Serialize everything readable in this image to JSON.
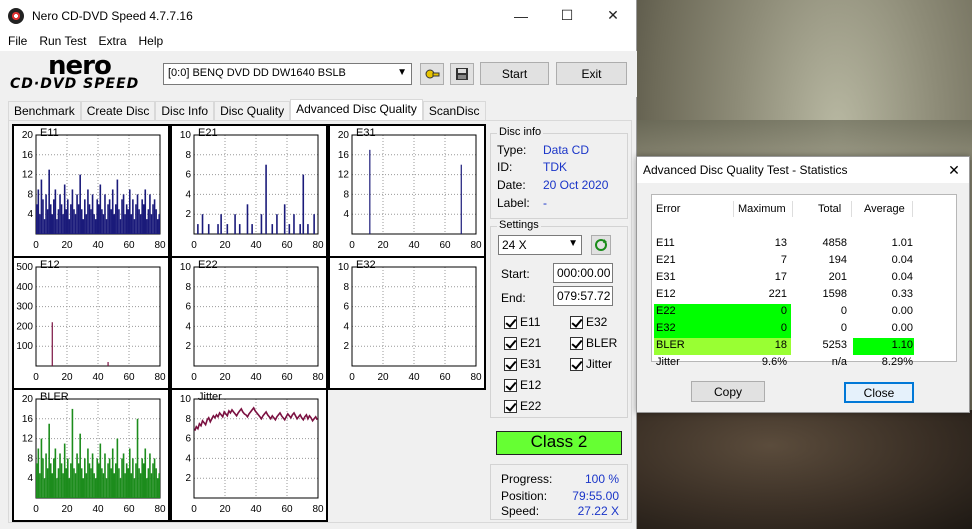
{
  "window": {
    "title": "Nero CD-DVD Speed 4.7.7.16"
  },
  "menu": [
    "File",
    "Run Test",
    "Extra",
    "Help"
  ],
  "toolbar": {
    "logo_top": "nero",
    "logo_bottom": "CD·DVD SPEED",
    "drive": "[0:0]   BENQ DVD DD DW1640 BSLB",
    "start_label": "Start",
    "exit_label": "Exit"
  },
  "tabs": [
    "Benchmark",
    "Create Disc",
    "Disc Info",
    "Disc Quality",
    "Advanced Disc Quality",
    "ScanDisc"
  ],
  "active_tab": "Advanced Disc Quality",
  "disc_info": {
    "title": "Disc info",
    "type_label": "Type:",
    "type": "Data CD",
    "id_label": "ID:",
    "id": "TDK",
    "date_label": "Date:",
    "date": "20 Oct 2020",
    "label_label": "Label:",
    "label": "-"
  },
  "settings": {
    "title": "Settings",
    "speed": "24 X",
    "start_label": "Start:",
    "start": "000:00.00",
    "end_label": "End:",
    "end": "079:57.72",
    "checks": [
      "E11",
      "E32",
      "E21",
      "BLER",
      "E31",
      "Jitter",
      "E12",
      "E22"
    ]
  },
  "class_label": "Class 2",
  "progress": {
    "progress_label": "Progress:",
    "progress": "100 %",
    "position_label": "Position:",
    "position": "79:55.00",
    "speed_label": "Speed:",
    "speed": "27.22 X"
  },
  "colors": {
    "error_series": "#1a1a7a",
    "bler_series": "#1c8c1c",
    "jitter_series": "#7a1040",
    "green_highlight": "#00ff00",
    "yellow_green_highlight": "#99ff33"
  },
  "chart_data": [
    {
      "type": "bar",
      "title": "E11",
      "xlim": [
        0,
        80
      ],
      "ylim": [
        0,
        20
      ],
      "yticks": [
        4,
        8,
        12,
        16,
        20
      ],
      "xticks": [
        0,
        20,
        40,
        60,
        80
      ],
      "values": [
        6,
        9,
        4,
        11,
        7,
        3,
        8,
        5,
        13,
        6,
        4,
        7,
        9,
        3,
        5,
        8,
        6,
        4,
        10,
        5,
        7,
        3,
        6,
        9,
        5,
        4,
        8,
        6,
        12,
        5,
        3,
        7,
        4,
        9,
        6,
        5,
        8,
        4,
        3,
        7,
        6,
        10,
        5,
        4,
        8,
        3,
        6,
        7,
        5,
        9,
        4,
        6,
        11,
        5,
        3,
        7,
        8,
        4,
        6,
        5,
        9,
        4,
        7,
        3,
        6,
        8,
        5,
        4,
        7,
        6,
        9,
        3,
        5,
        8,
        4,
        6,
        7,
        5,
        3,
        4
      ]
    },
    {
      "type": "bar",
      "title": "E21",
      "xlim": [
        0,
        80
      ],
      "ylim": [
        0,
        10
      ],
      "yticks": [
        2,
        4,
        6,
        8,
        10
      ],
      "xticks": [
        0,
        20,
        40,
        60,
        80
      ],
      "values": [
        0,
        0,
        1,
        0,
        0,
        2,
        0,
        0,
        0,
        1,
        0,
        0,
        0,
        0,
        0,
        1,
        0,
        2,
        0,
        0,
        0,
        1,
        0,
        0,
        0,
        0,
        2,
        0,
        0,
        1,
        0,
        0,
        0,
        0,
        3,
        0,
        0,
        1,
        0,
        0,
        0,
        0,
        0,
        2,
        0,
        0,
        7,
        0,
        0,
        0,
        1,
        0,
        0,
        2,
        0,
        0,
        0,
        0,
        3,
        0,
        0,
        1,
        0,
        0,
        2,
        0,
        0,
        0,
        1,
        0,
        6,
        0,
        0,
        1,
        0,
        0,
        0,
        2,
        0,
        0
      ]
    },
    {
      "type": "bar",
      "title": "E31",
      "xlim": [
        0,
        80
      ],
      "ylim": [
        0,
        20
      ],
      "yticks": [
        4,
        8,
        12,
        16,
        20
      ],
      "xticks": [
        0,
        20,
        40,
        60,
        80
      ],
      "values": [
        0,
        0,
        0,
        0,
        0,
        0,
        0,
        0,
        0,
        0,
        0,
        17,
        0,
        0,
        0,
        0,
        0,
        0,
        0,
        0,
        0,
        0,
        0,
        0,
        0,
        0,
        0,
        0,
        0,
        0,
        0,
        0,
        0,
        0,
        0,
        0,
        0,
        0,
        0,
        0,
        0,
        0,
        0,
        0,
        0,
        0,
        0,
        0,
        0,
        0,
        0,
        0,
        0,
        0,
        0,
        0,
        0,
        0,
        0,
        0,
        0,
        0,
        0,
        0,
        0,
        0,
        0,
        0,
        0,
        0,
        14,
        0,
        0,
        0,
        0,
        0,
        0,
        0,
        0,
        0
      ]
    },
    {
      "type": "bar",
      "title": "E12",
      "xlim": [
        0,
        80
      ],
      "ylim": [
        0,
        500
      ],
      "yticks": [
        100,
        200,
        300,
        400,
        500
      ],
      "xticks": [
        0,
        20,
        40,
        60,
        80
      ],
      "values": [
        0,
        0,
        0,
        0,
        0,
        0,
        0,
        0,
        0,
        0,
        221,
        0,
        0,
        0,
        0,
        0,
        0,
        0,
        0,
        0,
        0,
        0,
        0,
        0,
        0,
        0,
        0,
        0,
        0,
        0,
        0,
        0,
        0,
        0,
        0,
        0,
        0,
        0,
        0,
        0,
        0,
        0,
        0,
        0,
        0,
        0,
        20,
        0,
        0,
        0,
        0,
        0,
        0,
        0,
        0,
        0,
        0,
        0,
        0,
        0,
        0,
        0,
        0,
        0,
        0,
        0,
        0,
        0,
        0,
        0,
        0,
        0,
        0,
        0,
        0,
        0,
        0,
        0,
        0,
        0
      ]
    },
    {
      "type": "bar",
      "title": "E22",
      "xlim": [
        0,
        80
      ],
      "ylim": [
        0,
        10
      ],
      "yticks": [
        2,
        4,
        6,
        8,
        10
      ],
      "xticks": [
        0,
        20,
        40,
        60,
        80
      ],
      "values": []
    },
    {
      "type": "bar",
      "title": "E32",
      "xlim": [
        0,
        80
      ],
      "ylim": [
        0,
        10
      ],
      "yticks": [
        2,
        4,
        6,
        8,
        10
      ],
      "xticks": [
        0,
        20,
        40,
        60,
        80
      ],
      "values": []
    },
    {
      "type": "bar",
      "title": "BLER",
      "xlim": [
        0,
        80
      ],
      "ylim": [
        0,
        20
      ],
      "yticks": [
        4,
        8,
        12,
        16,
        20
      ],
      "xticks": [
        0,
        20,
        40,
        60,
        80
      ],
      "values": [
        7,
        10,
        5,
        12,
        8,
        4,
        9,
        6,
        15,
        7,
        5,
        8,
        10,
        4,
        6,
        9,
        7,
        5,
        11,
        6,
        8,
        4,
        7,
        18,
        6,
        5,
        9,
        7,
        13,
        6,
        4,
        8,
        5,
        10,
        7,
        6,
        9,
        5,
        4,
        8,
        7,
        11,
        6,
        5,
        9,
        4,
        7,
        8,
        6,
        10,
        5,
        7,
        12,
        6,
        4,
        8,
        9,
        5,
        7,
        6,
        10,
        5,
        8,
        4,
        7,
        16,
        6,
        5,
        8,
        7,
        10,
        4,
        6,
        9,
        5,
        7,
        8,
        6,
        4,
        5
      ]
    },
    {
      "type": "line",
      "title": "Jitter",
      "xlim": [
        0,
        80
      ],
      "ylim": [
        0,
        10
      ],
      "yticks": [
        2,
        4,
        6,
        8,
        10
      ],
      "xticks": [
        0,
        20,
        40,
        60,
        80
      ],
      "values": [
        6.8,
        7.2,
        7.0,
        7.5,
        7.3,
        7.8,
        7.6,
        7.4,
        7.9,
        8.1,
        7.7,
        8.0,
        8.3,
        8.1,
        8.4,
        8.2,
        8.6,
        8.4,
        8.2,
        8.7,
        8.5,
        8.3,
        8.8,
        8.6,
        8.9,
        8.7,
        8.5,
        8.3,
        8.6,
        8.8,
        9.0,
        8.7,
        8.5,
        8.4,
        8.2,
        8.5,
        8.7,
        8.9,
        9.1,
        8.8,
        8.6,
        8.4,
        8.2,
        8.0,
        8.3,
        8.5,
        8.7,
        8.4,
        8.2,
        8.0,
        8.3,
        8.1,
        7.9,
        8.2,
        8.4,
        8.6,
        8.3,
        8.1,
        7.9,
        8.2,
        8.5,
        8.3,
        8.1,
        8.4,
        8.6,
        8.3,
        8.0,
        8.2,
        8.4,
        8.1,
        7.9,
        8.2,
        8.4,
        8.0,
        8.3,
        8.1,
        7.8,
        8.0,
        8.2,
        7.9
      ]
    }
  ],
  "stats": {
    "title": "Advanced Disc Quality Test - Statistics",
    "headers": [
      "Error",
      "Maximum",
      "Total",
      "Average"
    ],
    "rows": [
      {
        "name": "E11",
        "max": "13",
        "total": "4858",
        "avg": "1.01",
        "hl_name": "",
        "hl_avg": ""
      },
      {
        "name": "E21",
        "max": "7",
        "total": "194",
        "avg": "0.04",
        "hl_name": "",
        "hl_avg": ""
      },
      {
        "name": "E31",
        "max": "17",
        "total": "201",
        "avg": "0.04",
        "hl_name": "",
        "hl_avg": ""
      },
      {
        "name": "E12",
        "max": "221",
        "total": "1598",
        "avg": "0.33",
        "hl_name": "",
        "hl_avg": ""
      },
      {
        "name": "E22",
        "max": "0",
        "total": "0",
        "avg": "0.00",
        "hl_name": "#00ff00",
        "hl_avg": ""
      },
      {
        "name": "E32",
        "max": "0",
        "total": "0",
        "avg": "0.00",
        "hl_name": "#00ff00",
        "hl_avg": ""
      },
      {
        "name": "BLER",
        "max": "18",
        "total": "5253",
        "avg": "1.10",
        "hl_name": "#99ff33",
        "hl_avg": "#00ff00"
      },
      {
        "name": "Jitter",
        "max": "9.6%",
        "total": "n/a",
        "avg": "8.29%",
        "hl_name": "",
        "hl_avg": ""
      }
    ],
    "copy_label": "Copy",
    "close_label": "Close"
  }
}
